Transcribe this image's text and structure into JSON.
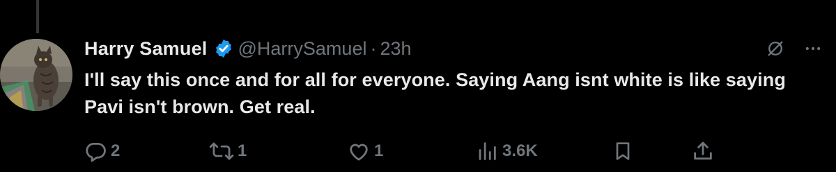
{
  "tweet": {
    "display_name": "Harry Samuel",
    "handle": "@HarrySamuel",
    "separator": "·",
    "timestamp": "23h",
    "text": "I'll say this once and for all for everyone. Saying Aang isnt white is like saying Pavi isn't brown. Get real.",
    "verified": true
  },
  "actions": {
    "reply_count": "2",
    "retweet_count": "1",
    "like_count": "1",
    "views_count": "3.6K"
  },
  "icons": {
    "verified": "verified-badge-icon",
    "grok": "grok-icon",
    "more": "more-dots-icon",
    "reply": "reply-icon",
    "retweet": "retweet-icon",
    "like": "heart-icon",
    "views": "views-bar-chart-icon",
    "bookmark": "bookmark-icon",
    "share": "share-icon"
  },
  "colors": {
    "background": "#000000",
    "primary_text": "#e7e9ea",
    "secondary_text": "#71767b",
    "verified_blue": "#1d9bf0",
    "thread_line": "#333639"
  }
}
